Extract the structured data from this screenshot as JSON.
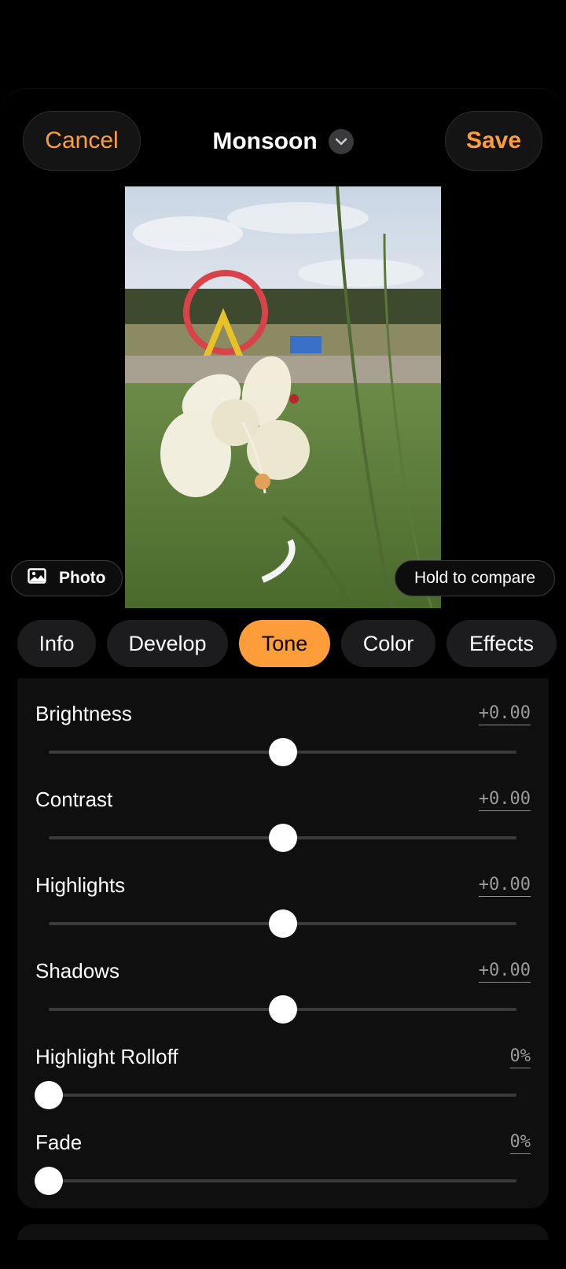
{
  "header": {
    "cancel_label": "Cancel",
    "title": "Monsoon",
    "save_label": "Save"
  },
  "preview": {
    "photo_chip_label": "Photo",
    "compare_label": "Hold to compare"
  },
  "tabs": [
    {
      "label": "Info",
      "active": false
    },
    {
      "label": "Develop",
      "active": false
    },
    {
      "label": "Tone",
      "active": true
    },
    {
      "label": "Color",
      "active": false
    },
    {
      "label": "Effects",
      "active": false
    }
  ],
  "adjustments": [
    {
      "label": "Brightness",
      "value": "+0.00",
      "level": 0.5
    },
    {
      "label": "Contrast",
      "value": "+0.00",
      "level": 0.5
    },
    {
      "label": "Highlights",
      "value": "+0.00",
      "level": 0.5
    },
    {
      "label": "Shadows",
      "value": "+0.00",
      "level": 0.5
    },
    {
      "label": "Highlight Rolloff",
      "value": "0%",
      "level": 0
    },
    {
      "label": "Fade",
      "value": "0%",
      "level": 0
    }
  ],
  "colors": {
    "accent": "#ff9d3b",
    "background": "#000000",
    "panel": "#0f0f0f"
  },
  "icons": {
    "title_dropdown": "chevron-down-icon",
    "photo_chip": "image-icon"
  }
}
